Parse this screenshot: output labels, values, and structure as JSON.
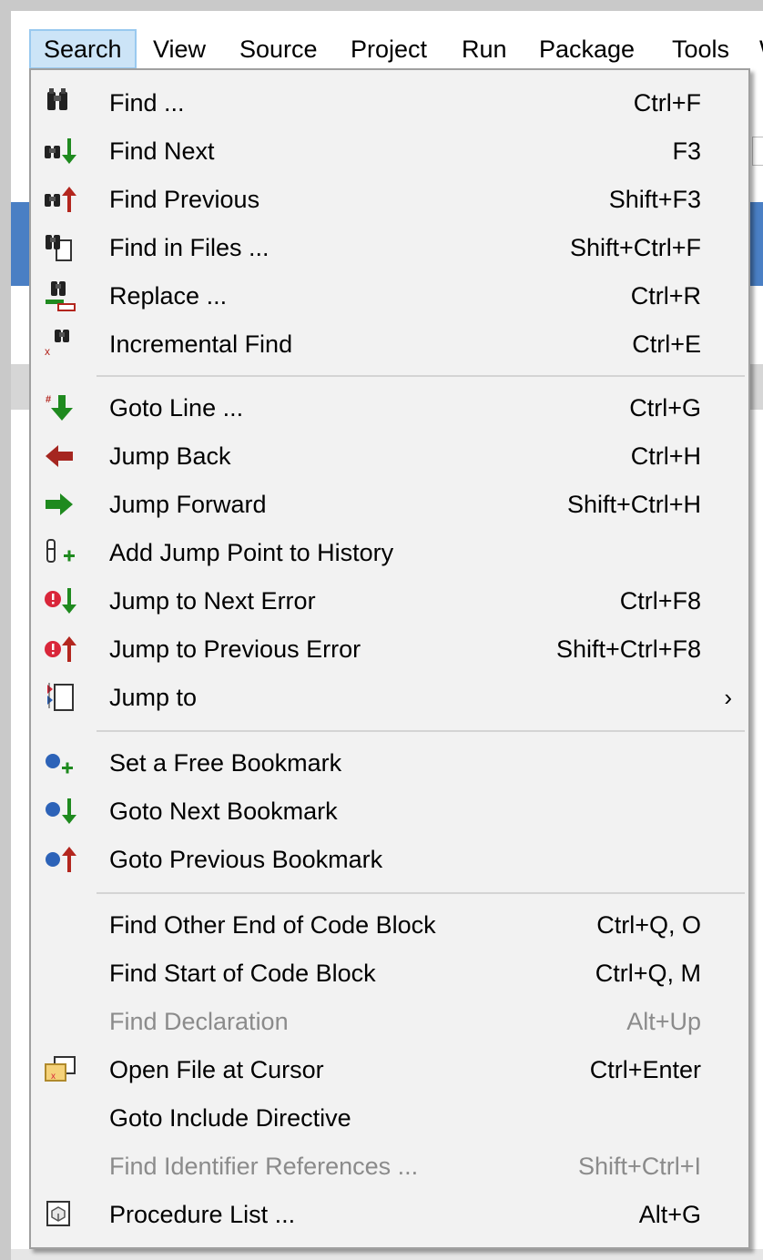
{
  "menubar": {
    "items": [
      "Search",
      "View",
      "Source",
      "Project",
      "Run",
      "Package",
      "Tools",
      "W"
    ]
  },
  "menu": {
    "items": [
      {
        "label": "Find ...",
        "shortcut": "Ctrl+F",
        "icon": "binoculars-icon"
      },
      {
        "label": "Find Next",
        "shortcut": "F3",
        "icon": "find-next-icon"
      },
      {
        "label": "Find Previous",
        "shortcut": "Shift+F3",
        "icon": "find-previous-icon"
      },
      {
        "label": "Find in Files ...",
        "shortcut": "Shift+Ctrl+F",
        "icon": "find-in-files-icon"
      },
      {
        "label": "Replace ...",
        "shortcut": "Ctrl+R",
        "icon": "replace-icon"
      },
      {
        "label": "Incremental Find",
        "shortcut": "Ctrl+E",
        "icon": "incremental-find-icon"
      },
      {
        "label": "Goto Line ...",
        "shortcut": "Ctrl+G",
        "icon": "goto-line-icon"
      },
      {
        "label": "Jump Back",
        "shortcut": "Ctrl+H",
        "icon": "arrow-left-icon"
      },
      {
        "label": "Jump Forward",
        "shortcut": "Shift+Ctrl+H",
        "icon": "arrow-right-icon"
      },
      {
        "label": "Add Jump Point to History",
        "shortcut": "",
        "icon": "add-jump-point-icon"
      },
      {
        "label": "Jump to Next Error",
        "shortcut": "Ctrl+F8",
        "icon": "next-error-icon"
      },
      {
        "label": "Jump to Previous Error",
        "shortcut": "Shift+Ctrl+F8",
        "icon": "previous-error-icon"
      },
      {
        "label": "Jump to",
        "shortcut": "",
        "icon": "jump-to-icon",
        "submenu": "›"
      },
      {
        "label": "Set a Free Bookmark",
        "shortcut": "",
        "icon": "set-bookmark-icon"
      },
      {
        "label": "Goto Next Bookmark",
        "shortcut": "",
        "icon": "next-bookmark-icon"
      },
      {
        "label": "Goto Previous Bookmark",
        "shortcut": "",
        "icon": "previous-bookmark-icon"
      },
      {
        "label": "Find Other End of Code Block",
        "shortcut": "Ctrl+Q, O",
        "icon": ""
      },
      {
        "label": "Find Start of Code Block",
        "shortcut": "Ctrl+Q, M",
        "icon": ""
      },
      {
        "label": "Find Declaration",
        "shortcut": "Alt+Up",
        "icon": "",
        "disabled": true
      },
      {
        "label": "Open File at Cursor",
        "shortcut": "Ctrl+Enter",
        "icon": "open-file-icon"
      },
      {
        "label": "Goto Include Directive",
        "shortcut": "",
        "icon": ""
      },
      {
        "label": "Find Identifier References ...",
        "shortcut": "Shift+Ctrl+I",
        "icon": "",
        "disabled": true
      },
      {
        "label": "Procedure List ...",
        "shortcut": "Alt+G",
        "icon": "procedure-list-icon"
      }
    ]
  },
  "colors": {
    "menu_bg": "#f2f2f2",
    "highlight": "#cce4f7",
    "disabled_text": "#8b8b8b",
    "green": "#1f8a1f",
    "red": "#b3261e",
    "blue": "#2d63b8"
  }
}
